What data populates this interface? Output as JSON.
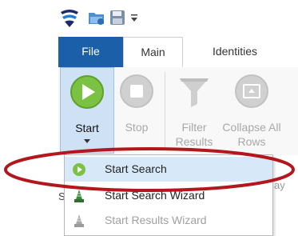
{
  "quick_access": {
    "icons": [
      "app-logo-icon",
      "open-folder-icon",
      "save-icon",
      "customize-dropdown-icon"
    ]
  },
  "tabs": [
    {
      "label": "File",
      "active": false,
      "accent": "#1b5fa8"
    },
    {
      "label": "Main",
      "active": true
    },
    {
      "label": "Identities",
      "active": false
    }
  ],
  "ribbon": {
    "start": {
      "label": "Start",
      "icon": "play-circle-icon",
      "color": "#7cc242"
    },
    "stop": {
      "label": "Stop",
      "icon": "stop-circle-icon"
    },
    "filter_results": {
      "label": "Filter Results",
      "icon": "funnel-icon"
    },
    "collapse_all_rows": {
      "label": "Collapse All Rows",
      "icon": "collapse-icon"
    }
  },
  "peek_text": {
    "right": "ay",
    "left": "S"
  },
  "menu": {
    "items": [
      {
        "label": "Start Search",
        "icon": "play-circle-icon",
        "enabled": true,
        "highlighted": true
      },
      {
        "label": "Start Search Wizard",
        "icon": "wizard-icon",
        "enabled": true
      },
      {
        "label": "Start Results Wizard",
        "icon": "wizard-icon",
        "enabled": false
      }
    ]
  },
  "annotation": {
    "shape": "ellipse",
    "color": "#b3161c"
  }
}
